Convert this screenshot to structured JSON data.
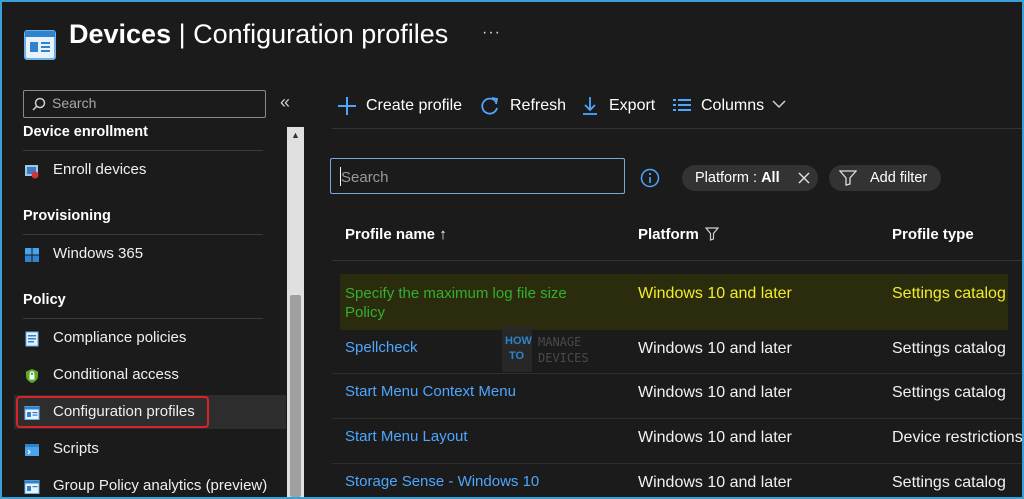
{
  "header": {
    "title_bold": "Devices",
    "title_rest": " | Configuration profiles",
    "more": "···"
  },
  "sidebar": {
    "search_placeholder": "Search",
    "collapse": "«",
    "groups": [
      {
        "label": "Device enrollment"
      },
      {
        "label": "Provisioning"
      },
      {
        "label": "Policy"
      }
    ],
    "items": [
      {
        "label": "Enroll devices",
        "icon": "enroll-devices-icon"
      },
      {
        "label": "Windows 365",
        "icon": "windows-icon"
      },
      {
        "label": "Compliance policies",
        "icon": "compliance-icon"
      },
      {
        "label": "Conditional access",
        "icon": "shield-lock-icon"
      },
      {
        "label": "Configuration profiles",
        "icon": "config-profile-icon",
        "selected": true
      },
      {
        "label": "Scripts",
        "icon": "script-icon"
      },
      {
        "label": "Group Policy analytics (preview)",
        "icon": "group-policy-icon"
      }
    ]
  },
  "toolbar": {
    "create": "Create profile",
    "refresh": "Refresh",
    "export": "Export",
    "columns": "Columns"
  },
  "filters": {
    "search_placeholder": "Search",
    "platform_prefix": "Platform : ",
    "platform_value": "All",
    "add_filter": "Add filter"
  },
  "table": {
    "columns": [
      "Profile name ↑",
      "Platform",
      "Profile type"
    ],
    "rows": [
      {
        "name_line1": "Specify the maximum log file size",
        "name_line2": "Policy",
        "platform": "Windows 10 and later",
        "type": "Settings catalog",
        "highlighted": true
      },
      {
        "name": "Spellcheck",
        "platform": "Windows 10 and later",
        "type": "Settings catalog"
      },
      {
        "name": "Start Menu Context Menu",
        "platform": "Windows 10 and later",
        "type": "Settings catalog"
      },
      {
        "name": "Start Menu Layout",
        "platform": "Windows 10 and later",
        "type": "Device restrictions"
      },
      {
        "name": "Storage Sense - Windows 10",
        "platform": "Windows 10 and later",
        "type": "Settings catalog"
      }
    ]
  },
  "watermark": {
    "how": "HOW",
    "to": "TO",
    "manage": "MANAGE",
    "devices": "DEVICES"
  },
  "colors": {
    "accent": "#4ea6ff",
    "highlight_text": "#f1ec2a",
    "highlight_name": "#33b02f",
    "selected_border": "#d9232a"
  }
}
